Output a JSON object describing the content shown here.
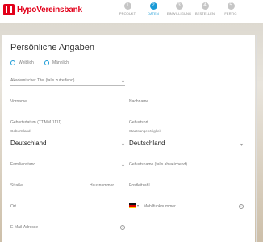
{
  "brand": {
    "name": "HypoVereinsbank",
    "accent": "#e2001a",
    "step_accent": "#1a9ad6"
  },
  "steps": [
    {
      "num": "1",
      "label": "PRODUKT",
      "state": "done"
    },
    {
      "num": "2",
      "label": "DATEN",
      "state": "active"
    },
    {
      "num": "3",
      "label": "EINWILLIGUNG",
      "state": "todo"
    },
    {
      "num": "4",
      "label": "BESTELLEN",
      "state": "todo"
    },
    {
      "num": "5",
      "label": "FERTIG",
      "state": "todo"
    }
  ],
  "form": {
    "title": "Persönliche Angaben",
    "radios": {
      "female": "Weiblich",
      "male": "Männlich"
    },
    "academic_title": "Akademischer Titel (falls zutreffend)",
    "first_name": "Vorname",
    "last_name": "Nachname",
    "birth_date": "Geburtsdatum (TT.MM.JJJJ)",
    "birth_name": "Geburtsort",
    "birth_country": {
      "label": "Geburtsland",
      "value": "Deutschland"
    },
    "nationality": {
      "label": "Staatsangehörigkeit",
      "value": "Deutschland"
    },
    "marital_status": "Familienstand",
    "birth_surname": "Geburtsname (falls abweichend)",
    "street": "Straße",
    "house_number": "Hausnummer",
    "postal_code": "Postleitzahl",
    "city": "Ort",
    "mobile": "Mobilfunknummer",
    "email": "E-Mail-Adresse"
  }
}
